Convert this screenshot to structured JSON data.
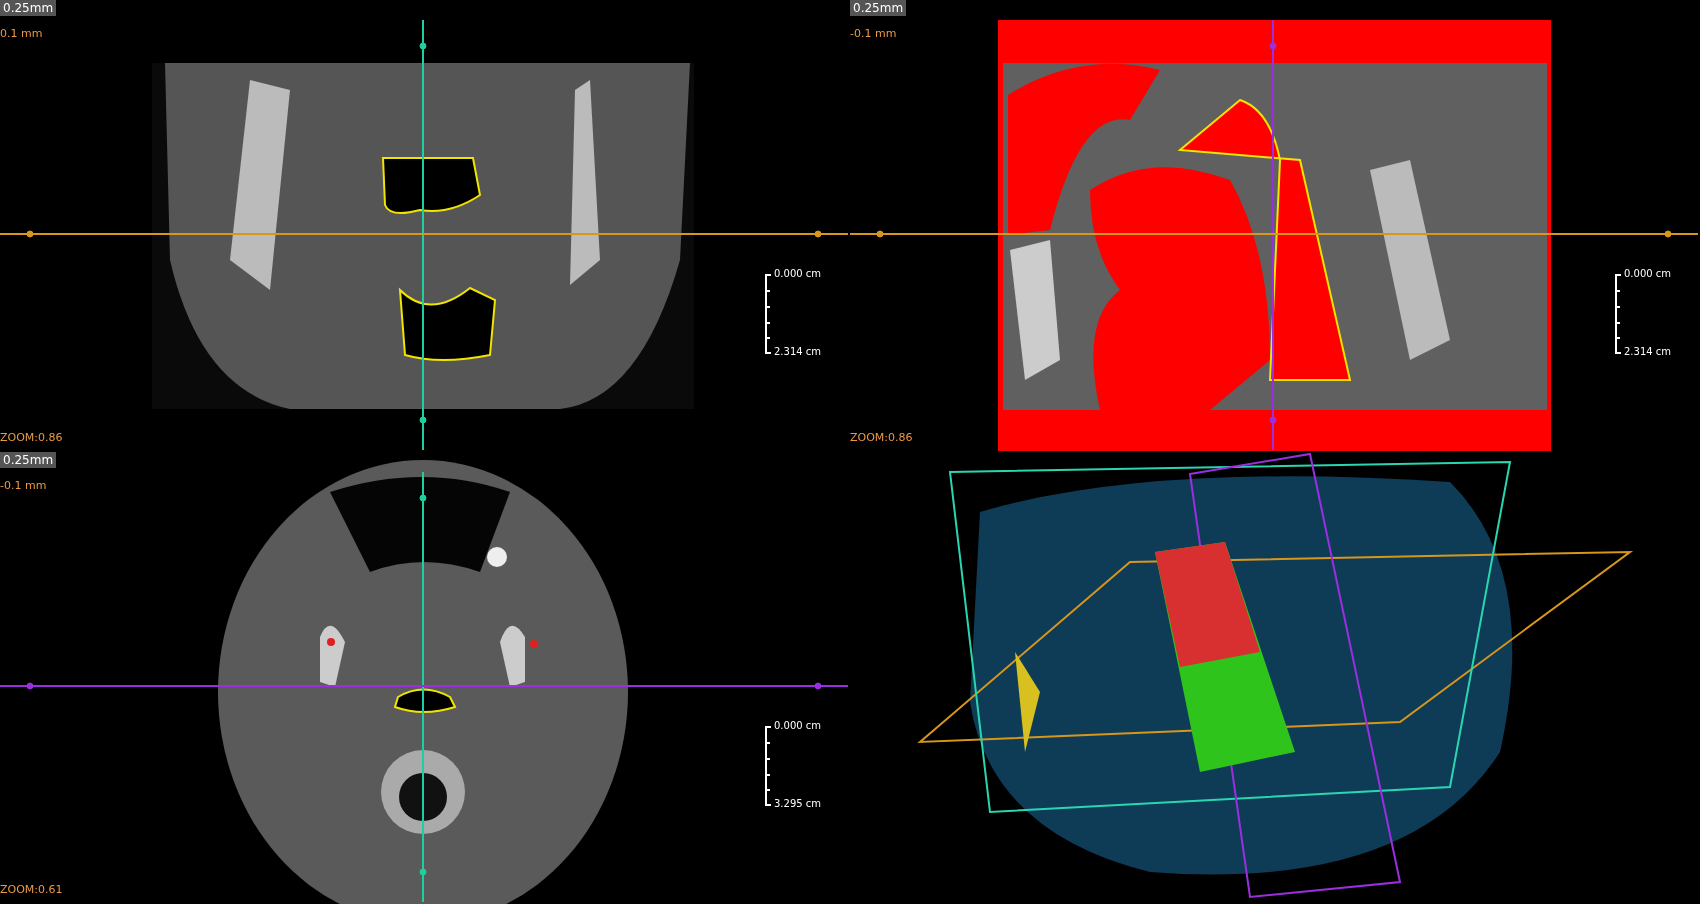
{
  "viewports": [
    {
      "kind": "coronal",
      "thickness": "0.25mm",
      "offset": "0.1 mm",
      "zoom": "ZOOM:0.86",
      "scale_top": "0.000 cm",
      "scale_bottom": "2.314 cm",
      "lines": [
        {
          "kind": "vertical",
          "color": "#1fcf9f"
        },
        {
          "kind": "horizontal",
          "color": "#d8961c"
        }
      ]
    },
    {
      "kind": "sagittal",
      "thickness": "0.25mm",
      "offset": "-0.1 mm",
      "zoom": "ZOOM:0.86",
      "scale_top": "0.000 cm",
      "scale_bottom": "2.314 cm",
      "lines": [
        {
          "kind": "vertical",
          "color": "#9b2ee0"
        },
        {
          "kind": "horizontal",
          "color": "#d8961c"
        }
      ]
    },
    {
      "kind": "axial",
      "thickness": "0.25mm",
      "offset": "-0.1 mm",
      "zoom": "ZOOM:0.61",
      "scale_top": "0.000 cm",
      "scale_bottom": "3.295 cm",
      "lines": [
        {
          "kind": "vertical",
          "color": "#1fcf9f"
        },
        {
          "kind": "horizontal",
          "color": "#9b2ee0"
        }
      ]
    },
    {
      "kind": "volume"
    }
  ]
}
